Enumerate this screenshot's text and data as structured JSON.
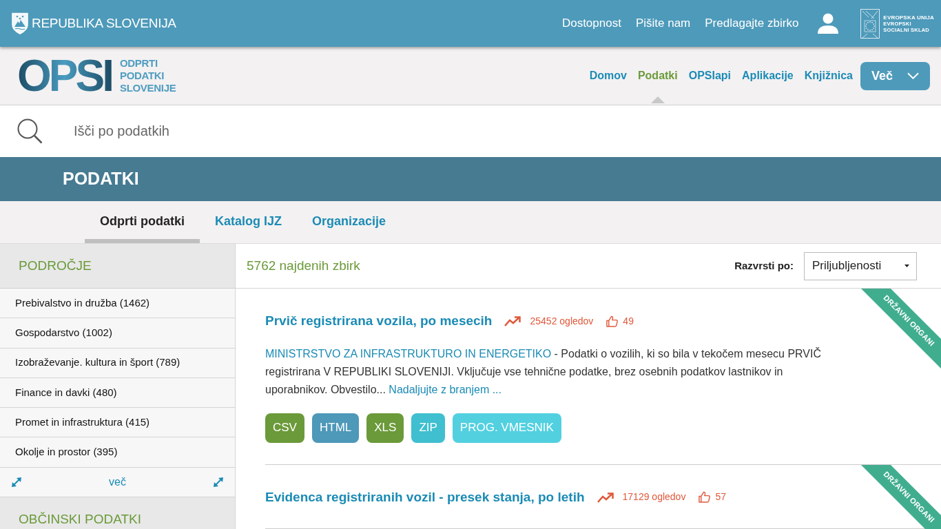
{
  "top_bar": {
    "title": "REPUBLIKA SLOVENIJA",
    "links": [
      "Dostopnost",
      "Pišite nam",
      "Predlagajte zbirko"
    ],
    "eu_logo": [
      "EVROPSKA UNIJA",
      "EVROPSKI",
      "SOCIALNI SKLAD"
    ]
  },
  "header": {
    "logo": {
      "mark": "OPSI",
      "tagline": [
        "ODPRTI",
        "PODATKI",
        "SLOVENIJE"
      ]
    },
    "nav": [
      {
        "label": "Domov",
        "selected": false
      },
      {
        "label": "Podatki",
        "selected": true
      },
      {
        "label": "OPSIapi",
        "selected": false
      },
      {
        "label": "Aplikacije",
        "selected": false
      },
      {
        "label": "Knjižnica",
        "selected": false
      }
    ],
    "more_button": "Več"
  },
  "search": {
    "placeholder": "Išči po podatkih"
  },
  "section": {
    "title": "PODATKI",
    "tabs": [
      {
        "label": "Odprti podatki",
        "selected": true
      },
      {
        "label": "Katalog IJZ",
        "selected": false
      },
      {
        "label": "Organizacije",
        "selected": false
      }
    ]
  },
  "sidebar": {
    "groups": [
      {
        "title": "PODROČJE",
        "items": [
          "Prebivalstvo in družba (1462)",
          "Gospodarstvo (1002)",
          "Izobraževanje. kultura in šport (789)",
          "Finance in davki (480)",
          "Promet in infrastruktura (415)",
          "Okolje in prostor (395)"
        ],
        "more": "več"
      },
      {
        "title": "OBČINSKI PODATKI"
      }
    ]
  },
  "results": {
    "count": "5762 najdenih zbirk",
    "sort": {
      "label": "Razvrsti po:",
      "value": "Priljubljenosti"
    },
    "items": [
      {
        "title": "Prvič registrirana vozila, po mesecih",
        "views": "25452 ogledov",
        "likes": "49",
        "ribbon": "DRŽAVNI ORGANI",
        "publisher": "MINISTRSTVO ZA INFRASTRUKTURO IN ENERGETIKO",
        "description": "- Podatki o vozilih, ki so bila v tekočem mesecu PRVIČ registrirana V REPUBLIKI SLOVENIJI. Vključuje vse tehnične podatke, brez osebnih podatkov lastnikov in uporabnikov. Obvestilo...",
        "read_more": "Nadaljujte z branjem ...",
        "formats": [
          {
            "label": "CSV",
            "color": "#6b9a3a"
          },
          {
            "label": "HTML",
            "color": "#4e98b9"
          },
          {
            "label": "XLS",
            "color": "#6b9a3a"
          },
          {
            "label": "ZIP",
            "color": "#3fbfcf"
          },
          {
            "label": "PROG. VMESNIK",
            "color": "#52d0e0"
          }
        ]
      },
      {
        "title": "Evidenca registriranih vozil - presek stanja, po letih",
        "views": "17129 ogledov",
        "likes": "57",
        "ribbon": "DRŽAVNI ORGANI"
      }
    ]
  }
}
